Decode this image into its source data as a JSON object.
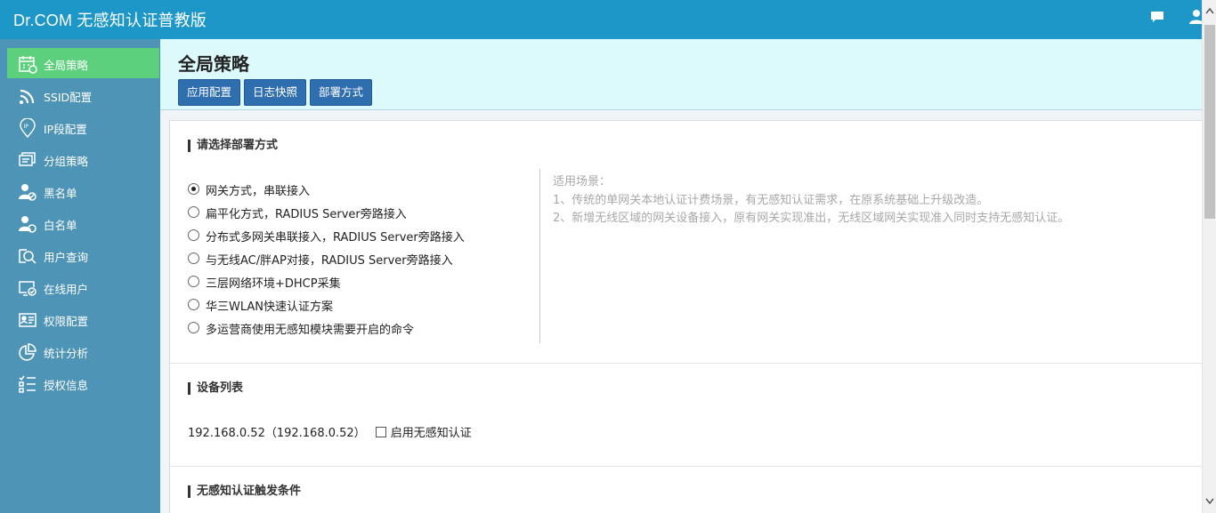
{
  "app": {
    "title": "Dr.COM 无感知认证普教版"
  },
  "topbar_icons": [
    "message-icon",
    "user-icon"
  ],
  "sidebar": {
    "items": [
      {
        "label": "全局策略",
        "icon": "calendar-icon",
        "active": true
      },
      {
        "label": "SSID配置",
        "icon": "wifi-icon",
        "active": false
      },
      {
        "label": "IP段配置",
        "icon": "location-pin-icon",
        "active": false
      },
      {
        "label": "分组策略",
        "icon": "group-icon",
        "active": false
      },
      {
        "label": "黑名单",
        "icon": "user-block-icon",
        "active": false
      },
      {
        "label": "白名单",
        "icon": "user-allow-icon",
        "active": false
      },
      {
        "label": "用户查询",
        "icon": "search-icon",
        "active": false
      },
      {
        "label": "在线用户",
        "icon": "monitor-check-icon",
        "active": false
      },
      {
        "label": "权限配置",
        "icon": "id-card-icon",
        "active": false
      },
      {
        "label": "统计分析",
        "icon": "pie-chart-icon",
        "active": false
      },
      {
        "label": "授权信息",
        "icon": "checklist-icon",
        "active": false
      }
    ]
  },
  "header": {
    "title": "全局策略",
    "tabs": [
      "应用配置",
      "日志快照",
      "部署方式"
    ]
  },
  "deploy": {
    "title": "请选择部署方式",
    "options": [
      {
        "label": "网关方式，串联接入",
        "checked": true
      },
      {
        "label": "扁平化方式，RADIUS Server旁路接入",
        "checked": false
      },
      {
        "label": "分布式多网关串联接入，RADIUS Server旁路接入",
        "checked": false
      },
      {
        "label": "与无线AC/胖AP对接，RADIUS Server旁路接入",
        "checked": false
      },
      {
        "label": "三层网络环境+DHCP采集",
        "checked": false
      },
      {
        "label": "华三WLAN快速认证方案",
        "checked": false
      },
      {
        "label": "多运营商使用无感知模块需要开启的命令",
        "checked": false
      }
    ],
    "hint": {
      "heading": "适用场景：",
      "lines": [
        "1、传统的单网关本地认证计费场景，有无感知认证需求，在原系统基础上升级改造。",
        "2、新增无线区域的网关设备接入，原有网关实现准出，无线区域网关实现准入同时支持无感知认证。"
      ]
    }
  },
  "devices": {
    "title": "设备列表",
    "items": [
      {
        "name": "192.168.0.52（192.168.0.52）",
        "checkbox_label": "启用无感知认证",
        "checked": false
      }
    ]
  },
  "trigger": {
    "title": "无感知认证触发条件"
  },
  "colors": {
    "topbar": "#1d97c8",
    "sidebar": "#4e94b6",
    "active_item": "#5cd07c",
    "button": "#2f6eaf",
    "header_bg": "#dcf9fc"
  }
}
